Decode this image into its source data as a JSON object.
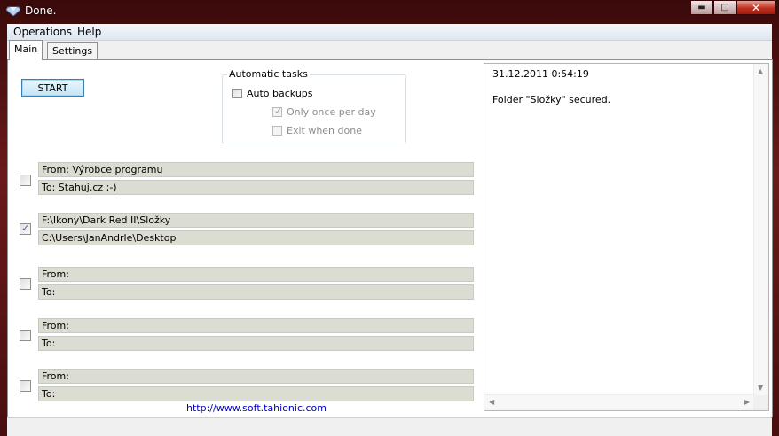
{
  "window": {
    "title": "Done."
  },
  "menu": [
    {
      "label": "Operations"
    },
    {
      "label": "Help"
    }
  ],
  "tabs": [
    {
      "label": "Main",
      "active": true
    },
    {
      "label": "Settings",
      "active": false
    }
  ],
  "main": {
    "start_label": "START",
    "auto": {
      "title": "Automatic tasks",
      "auto_backups": {
        "label": "Auto backups",
        "checked": false
      },
      "once_per_day": {
        "label": "Only once per day",
        "checked": true,
        "disabled": true
      },
      "exit_when_done": {
        "label": "Exit when done",
        "checked": false,
        "disabled": true
      }
    },
    "jobs": [
      {
        "checked": false,
        "from": "From: Výrobce programu",
        "to": "To: Stahuj.cz ;-)"
      },
      {
        "checked": true,
        "from": "F:\\Ikony\\Dark Red II\\Složky",
        "to": "C:\\Users\\JanAndrle\\Desktop"
      },
      {
        "checked": false,
        "from": "From:",
        "to": "To:"
      },
      {
        "checked": false,
        "from": "From:",
        "to": "To:"
      },
      {
        "checked": false,
        "from": "From:",
        "to": "To:"
      }
    ],
    "link": "http://www.soft.tahionic.com"
  },
  "log": {
    "lines": [
      "31.12.2011 0:54:19",
      "Folder \"Složky\" secured."
    ]
  }
}
